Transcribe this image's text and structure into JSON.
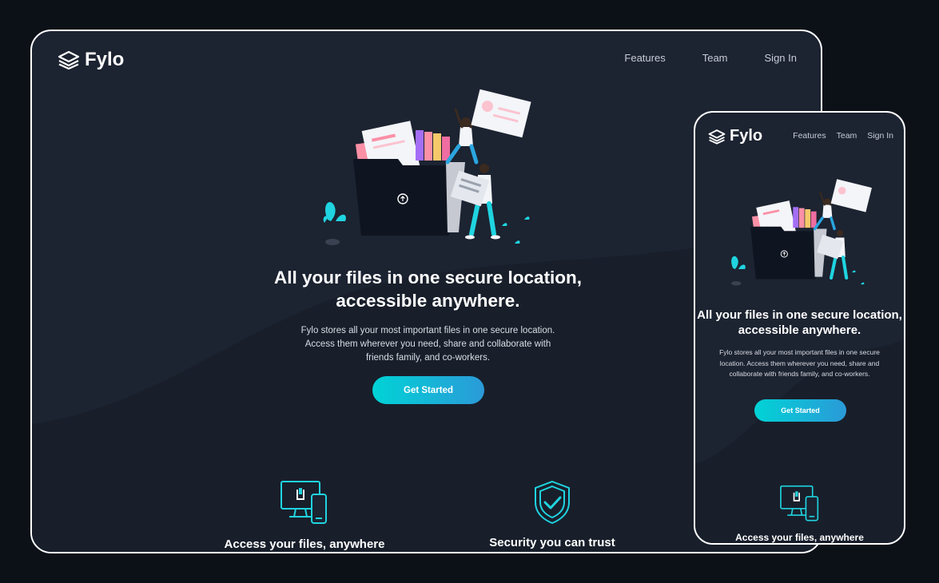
{
  "brand": {
    "name": "Fylo"
  },
  "nav": {
    "features": "Features",
    "team": "Team",
    "sign_in": "Sign In"
  },
  "hero": {
    "title_line1": "All your files in one secure location,",
    "title_line2": "accessible anywhere.",
    "body_line1": "Fylo stores all your most important files in one secure location.",
    "body_line2": "Access them wherever you need, share and collaborate with",
    "body_line3": "friends family, and co-workers.",
    "body_full": "Fylo stores all your most important files in one secure location. Access them wherever you need, share and collaborate with friends family, and co-workers.",
    "cta": "Get Started"
  },
  "features": [
    {
      "title": "Access your files, anywhere",
      "icon": "devices-icon"
    },
    {
      "title": "Security you can trust",
      "icon": "shield-check-icon"
    }
  ],
  "colors": {
    "page_background": "#0c1118",
    "surface": "#1c2331",
    "accent_cyan": "#00d3d6",
    "accent_blue": "#2b9ad8",
    "illustration_pink": "#fb90a6"
  }
}
